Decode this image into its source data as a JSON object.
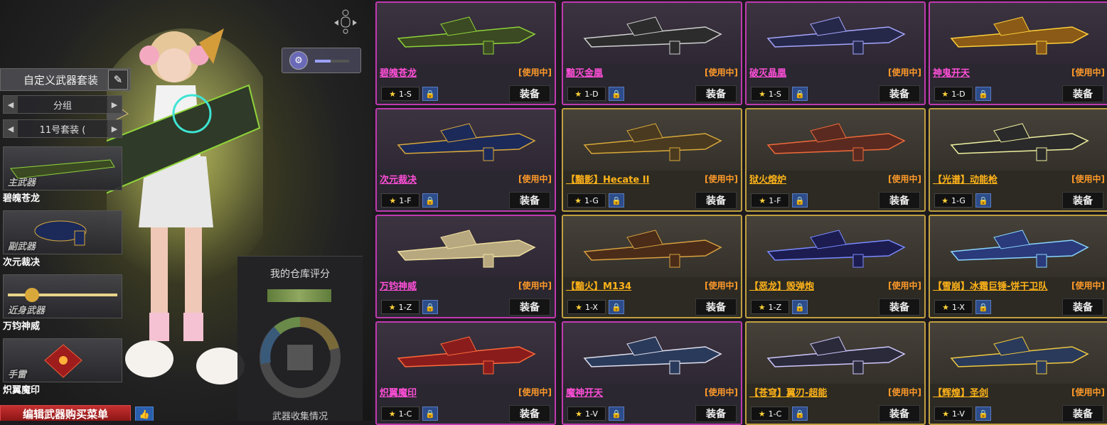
{
  "left": {
    "suit_label": "自定义武器套装",
    "group_selector": "分组",
    "set_selector": "11号套装 (",
    "slots": [
      {
        "tag": "主武器",
        "name": "碧魄苍龙"
      },
      {
        "tag": "副武器",
        "name": "次元裁决"
      },
      {
        "tag": "近身武器",
        "name": "万钧神威"
      },
      {
        "tag": "手雷",
        "name": "炽翼魔印"
      }
    ],
    "weapon_indicator_level": 0.45,
    "rating_title": "我的仓库评分",
    "rating_caption": "武器收集情况",
    "buy_button": "编辑武器购买菜单"
  },
  "common": {
    "in_use": "[使用中]",
    "equip": "装备",
    "star": "★"
  },
  "colors": {
    "pink_border": "#c03ab0",
    "gold_border": "#c0a040",
    "pink_name": "#ff4fd8",
    "gold_name": "#ffb31a"
  },
  "weapons": [
    {
      "name": "碧魄苍龙",
      "code": "1-S",
      "rarity": "pink"
    },
    {
      "name": "黯灭金凰",
      "code": "1-D",
      "rarity": "pink"
    },
    {
      "name": "破灭晶凰",
      "code": "1-S",
      "rarity": "pink"
    },
    {
      "name": "神鬼开天",
      "code": "1-D",
      "rarity": "pink"
    },
    {
      "name": "次元裁决",
      "code": "1-F",
      "rarity": "pink"
    },
    {
      "name": "【黯影】Hecate II",
      "code": "1-G",
      "rarity": "gold"
    },
    {
      "name": "狱火熔炉",
      "code": "1-F",
      "rarity": "gold"
    },
    {
      "name": "【光谱】动能枪",
      "code": "1-G",
      "rarity": "gold"
    },
    {
      "name": "万钧神威",
      "code": "1-Z",
      "rarity": "pink"
    },
    {
      "name": "【黯火】M134",
      "code": "1-X",
      "rarity": "gold"
    },
    {
      "name": "【恶龙】毁弹炮",
      "code": "1-Z",
      "rarity": "gold"
    },
    {
      "name": "【雪崩】冰霜巨锤-饼干卫队",
      "code": "1-X",
      "rarity": "gold"
    },
    {
      "name": "炽翼魔印",
      "code": "1-C",
      "rarity": "pink"
    },
    {
      "name": "魔神开天",
      "code": "1-V",
      "rarity": "pink"
    },
    {
      "name": "【苍穹】翼刃-超能",
      "code": "1-C",
      "rarity": "gold"
    },
    {
      "name": "【辉煌】圣剑",
      "code": "1-V",
      "rarity": "gold"
    }
  ]
}
